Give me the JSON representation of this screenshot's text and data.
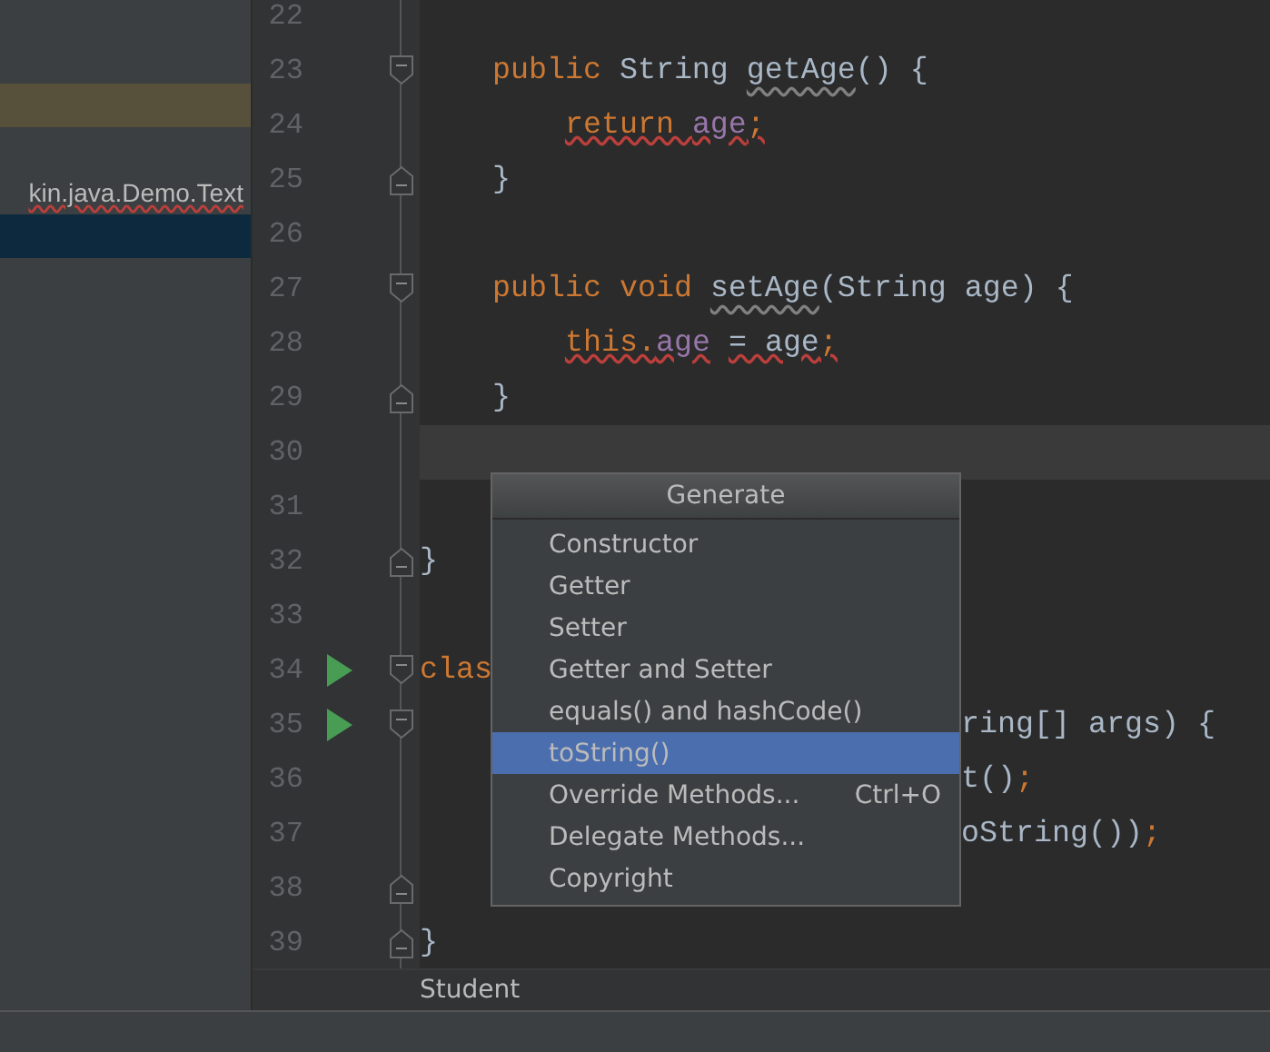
{
  "project_panel": {
    "rows": [
      {
        "current": true,
        "selected": false
      },
      {
        "current": false,
        "selected": false
      },
      {
        "current": false,
        "selected": false,
        "text": "kin.java.Demo.Text",
        "error": true
      },
      {
        "current": false,
        "selected": true
      }
    ]
  },
  "editor": {
    "lines": [
      {
        "number": "22",
        "current": false
      },
      {
        "number": "23",
        "current": false,
        "fold_start": true,
        "tokens": [
          {
            "kind": "keyword",
            "text": "    public ",
            "error": false,
            "warning": false
          },
          {
            "kind": "plain",
            "text": "String ",
            "error": false,
            "warning": false
          },
          {
            "kind": "method",
            "text": "getAge",
            "error": false,
            "warning": true
          },
          {
            "kind": "plain",
            "text": "() {",
            "error": false,
            "warning": false
          }
        ]
      },
      {
        "number": "24",
        "current": false,
        "tokens": [
          {
            "kind": "keyword",
            "text": "        return ",
            "error": true,
            "warning": false
          },
          {
            "kind": "field",
            "text": "age",
            "error": true,
            "warning": false
          },
          {
            "kind": "keyword",
            "text": ";",
            "error": true,
            "warning": false
          }
        ]
      },
      {
        "number": "25",
        "current": false,
        "fold_end": true,
        "tokens": [
          {
            "kind": "plain",
            "text": "    }",
            "error": false,
            "warning": false
          }
        ]
      },
      {
        "number": "26",
        "current": false
      },
      {
        "number": "27",
        "current": false,
        "fold_start": true,
        "tokens": [
          {
            "kind": "keyword",
            "text": "    public void ",
            "error": false,
            "warning": false
          },
          {
            "kind": "method",
            "text": "setAge",
            "error": false,
            "warning": true
          },
          {
            "kind": "plain",
            "text": "(String age) {",
            "error": false,
            "warning": false
          }
        ]
      },
      {
        "number": "28",
        "current": false,
        "tokens": [
          {
            "kind": "keyword",
            "text": "        this.",
            "error": true,
            "warning": false
          },
          {
            "kind": "field",
            "text": "age",
            "error": true,
            "warning": false
          },
          {
            "kind": "plain",
            "text": " = age",
            "error": true,
            "warning": false
          },
          {
            "kind": "keyword",
            "text": ";",
            "error": true,
            "warning": false
          }
        ]
      },
      {
        "number": "29",
        "current": false,
        "fold_end": true,
        "tokens": [
          {
            "kind": "plain",
            "text": "    }",
            "error": false,
            "warning": false
          }
        ]
      },
      {
        "number": "30",
        "current": true
      },
      {
        "number": "31",
        "current": false
      },
      {
        "number": "32",
        "current": false,
        "fold_end": true,
        "tokens": [
          {
            "kind": "plain",
            "text": "}",
            "error": false,
            "warning": false
          }
        ]
      },
      {
        "number": "33",
        "current": false
      },
      {
        "number": "34",
        "current": false,
        "run": true,
        "fold_start": true,
        "tokens": [
          {
            "kind": "keyword",
            "text": "clas",
            "error": false,
            "warning": false
          }
        ]
      },
      {
        "number": "35",
        "current": false,
        "run": true,
        "fold_start": true,
        "tail": true,
        "tokens": [
          {
            "kind": "plain",
            "text": "ring[] args) {",
            "error": false,
            "warning": false
          }
        ]
      },
      {
        "number": "36",
        "current": false,
        "tail": true,
        "tokens": [
          {
            "kind": "plain",
            "text": "t()",
            "error": false,
            "warning": false
          },
          {
            "kind": "keyword",
            "text": ";",
            "error": false,
            "warning": false
          }
        ]
      },
      {
        "number": "37",
        "current": false,
        "tail": true,
        "tokens": [
          {
            "kind": "plain",
            "text": "oString())",
            "error": false,
            "warning": false
          },
          {
            "kind": "keyword",
            "text": ";",
            "error": false,
            "warning": false
          }
        ]
      },
      {
        "number": "38",
        "current": false,
        "fold_end": true
      },
      {
        "number": "39",
        "current": false,
        "fold_end": true,
        "tokens": [
          {
            "kind": "plain",
            "text": "}",
            "error": false,
            "warning": false
          }
        ]
      }
    ],
    "breadcrumb": "Student"
  },
  "generate_popup": {
    "title": "Generate",
    "items": [
      {
        "label": "Constructor",
        "selected": false
      },
      {
        "label": "Getter",
        "selected": false
      },
      {
        "label": "Setter",
        "selected": false
      },
      {
        "label": "Getter and Setter",
        "selected": false
      },
      {
        "label": "equals() and hashCode()",
        "selected": false
      },
      {
        "label": "toString()",
        "selected": true
      },
      {
        "label": "Override Methods...",
        "shortcut": "Ctrl+O",
        "selected": false
      },
      {
        "label": "Delegate Methods...",
        "selected": false
      },
      {
        "label": "Copyright",
        "selected": false
      }
    ]
  }
}
